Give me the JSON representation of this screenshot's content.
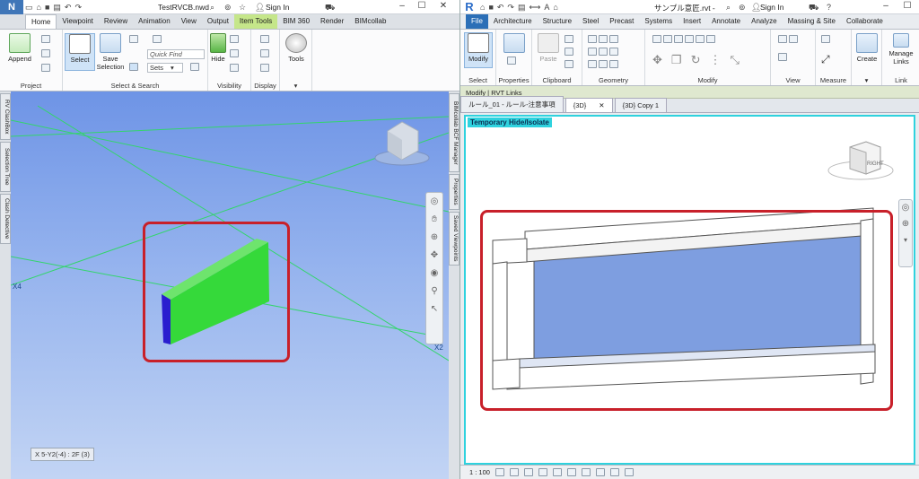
{
  "navisworks": {
    "app_logo": "N",
    "title": "TestRVCB.nwd",
    "sign_in": "Sign In",
    "tabs": [
      {
        "label": "Home",
        "active": true
      },
      {
        "label": "Viewpoint"
      },
      {
        "label": "Review"
      },
      {
        "label": "Animation"
      },
      {
        "label": "View"
      },
      {
        "label": "Output"
      },
      {
        "label": "Item Tools",
        "highlight": true
      },
      {
        "label": "BIM 360"
      },
      {
        "label": "Render"
      },
      {
        "label": "BIMcollab"
      }
    ],
    "ribbon": {
      "append": "Append",
      "select": "Select",
      "save_selection_1": "Save",
      "save_selection_2": "Selection",
      "quick_find": "Quick Find",
      "sets": "Sets",
      "hide": "Hide",
      "tools": "Tools",
      "groups": {
        "project": "Project",
        "select_search": "Select & Search",
        "visibility": "Visibility",
        "display": "Display"
      }
    },
    "side_left": [
      "RV ClashBox",
      "Selection Tree",
      "Clash Detective"
    ],
    "side_right": [
      "BIMcollab BCF Manager",
      "Properties",
      "Saved Viewpoints"
    ],
    "grid_labels": {
      "x4": "X4",
      "x2": "X2"
    },
    "status": "X 5-Y2(-4) : 2F (3)",
    "colors": {
      "viewport_top": "#6e94e6",
      "panel": "#35d93a",
      "panel_edge": "#2a1ecf",
      "grid": "#33d56b",
      "highlight": "#c8202a"
    }
  },
  "revit": {
    "app_logo": "R",
    "title": "サンプル意匠.rvt -",
    "sign_in": "Sign In",
    "tabs": [
      {
        "label": "File",
        "file": true
      },
      {
        "label": "Architecture"
      },
      {
        "label": "Structure"
      },
      {
        "label": "Steel"
      },
      {
        "label": "Precast"
      },
      {
        "label": "Systems"
      },
      {
        "label": "Insert"
      },
      {
        "label": "Annotate"
      },
      {
        "label": "Analyze"
      },
      {
        "label": "Massing & Site"
      },
      {
        "label": "Collaborate"
      }
    ],
    "ribbon": {
      "modify": "Modify",
      "paste": "Paste",
      "create": "Create",
      "manage_links_1": "Manage",
      "manage_links_2": "Links",
      "groups": [
        "Select",
        "Properties",
        "Clipboard",
        "Geometry",
        "Modify",
        "View",
        "Measure",
        "Link"
      ]
    },
    "mode_bar": "Modify | RVT Links",
    "view_tabs": [
      {
        "label": "ルール_01 - ルール-注意事項"
      },
      {
        "label": "{3D}",
        "current": true
      },
      {
        "label": "{3D} Copy 1"
      }
    ],
    "viewport_label": "Temporary Hide/Isolate",
    "viewcube_face": "RIGHT",
    "scale": "1 : 100",
    "colors": {
      "accent": "#2fd2de",
      "glass": "#7e9ee0",
      "highlight": "#c8202a"
    }
  }
}
